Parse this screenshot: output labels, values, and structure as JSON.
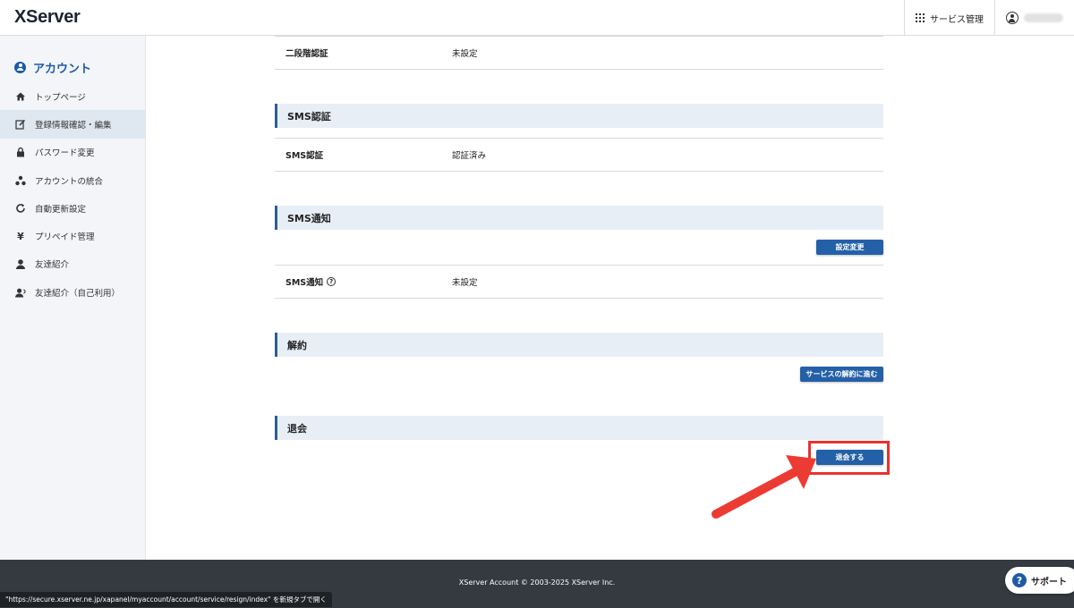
{
  "header": {
    "logo": "XServer",
    "service_menu_label": "サービス管理"
  },
  "sidebar": {
    "title": "アカウント",
    "items": [
      {
        "label": "トップページ",
        "icon": "home-icon"
      },
      {
        "label": "登録情報確認・編集",
        "icon": "edit-icon",
        "active": true
      },
      {
        "label": "パスワード変更",
        "icon": "lock-icon"
      },
      {
        "label": "アカウントの統合",
        "icon": "merge-icon"
      },
      {
        "label": "自動更新設定",
        "icon": "refresh-icon"
      },
      {
        "label": "プリペイド管理",
        "icon": "yen-icon"
      },
      {
        "label": "友達紹介",
        "icon": "friend-icon"
      },
      {
        "label": "友達紹介（自己利用）",
        "icon": "friend-self-icon"
      }
    ]
  },
  "main": {
    "two_factor": {
      "label": "二段階認証",
      "value": "未設定"
    },
    "sms_auth": {
      "heading": "SMS認証",
      "label": "SMS認証",
      "value": "認証済み"
    },
    "sms_notify": {
      "heading": "SMS通知",
      "button": "設定変更",
      "label": "SMS通知",
      "value": "未設定"
    },
    "cancel": {
      "heading": "解約",
      "button": "サービスの解約に進む"
    },
    "withdraw": {
      "heading": "退会",
      "button": "退会する"
    }
  },
  "footer": {
    "copyright": "XServer Account © 2003-2025 XServer Inc.",
    "status_url": "\"https://secure.xserver.ne.jp/xapanel/myaccount/account/service/resign/index\" を新規タブで開く",
    "support_label": "サポート"
  },
  "colors": {
    "accent": "#2460a7",
    "highlight": "#e8322f",
    "footer_bg": "#343a40"
  }
}
